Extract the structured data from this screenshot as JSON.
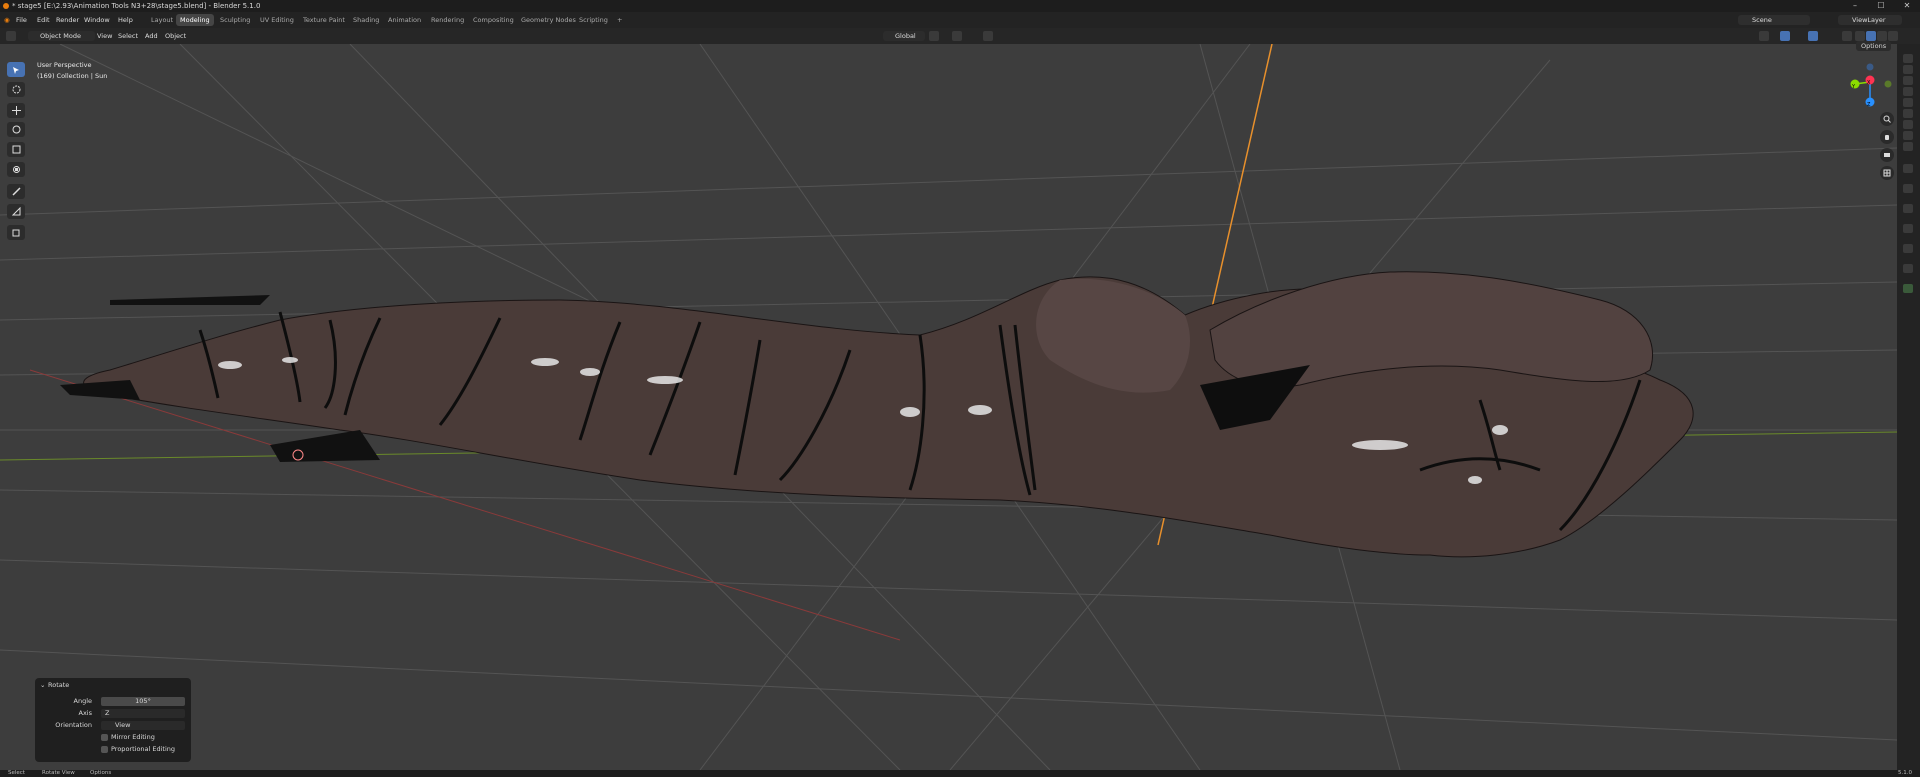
{
  "window": {
    "title": "* stage5 [E:\\2.93\\Animation Tools N3+28\\stage5.blend] - Blender 5.1.0",
    "controls": [
      "–",
      "☐",
      "✕"
    ]
  },
  "menubar": {
    "menus": [
      "File",
      "Edit",
      "Render",
      "Window",
      "Help"
    ],
    "workspaces": [
      "Layout",
      "Modeling",
      "Sculpting",
      "UV Editing",
      "Texture Paint",
      "Shading",
      "Animation",
      "Rendering",
      "Compositing",
      "Geometry Nodes",
      "Scripting"
    ],
    "active_workspace": "Modeling",
    "add_workspace": "+",
    "scene": "Scene",
    "view_layer": "ViewLayer"
  },
  "header": {
    "mode": "Object Mode",
    "menus": [
      "View",
      "Select",
      "Add",
      "Object"
    ],
    "orientation": "Global",
    "options": "Options"
  },
  "viewport": {
    "perspective": "User Perspective",
    "collection_info": "(169) Collection | Sun",
    "gizmo": {
      "x": "X",
      "y": "Y",
      "z": "Z"
    }
  },
  "operator_panel": {
    "title": "Rotate",
    "angle_label": "Angle",
    "angle_value": "105°",
    "axis_label": "Axis",
    "axis_value": "Z",
    "orientation_label": "Orientation",
    "orientation_value": "View",
    "mirror_label": "Mirror Editing",
    "proportional_label": "Proportional Editing"
  },
  "statusbar": {
    "items": [
      "Select",
      "Rotate View",
      "Options"
    ],
    "version": "5.1.0"
  },
  "colors": {
    "accent": "#4772b3",
    "orange": "#e87d0d",
    "axis_x": "#ff3352",
    "axis_y": "#8bdc00",
    "axis_z": "#2890ff",
    "mesh": "#4a3b38"
  }
}
